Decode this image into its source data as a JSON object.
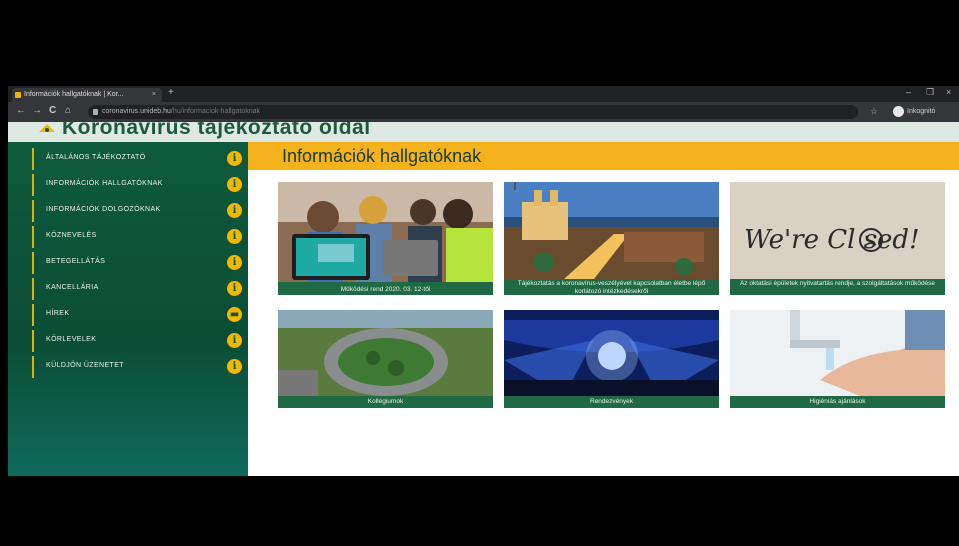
{
  "browser": {
    "tab_title": "Információk hallgatóknak | Kor...",
    "tab_close": "×",
    "new_tab": "+",
    "nav": {
      "back": "←",
      "forward": "→",
      "reload": "C",
      "home": "⌂"
    },
    "url_host": "coronavirus.unideb.hu",
    "url_path": "/hu/informaciok-hallgatoknak",
    "profile_label": "Inkognitó",
    "window_controls": {
      "minimize": "–",
      "restore": "❐",
      "close": "×"
    }
  },
  "site": {
    "title": "Koronavírus tájékoztató oldal",
    "sidebar": [
      {
        "label": "ÁLTALÁNOS TÁJÉKOZTATÓ",
        "icon": "info-icon",
        "glyph": "i"
      },
      {
        "label": "INFORMÁCIÓK HALLGATÓKNAK",
        "icon": "info-icon",
        "glyph": "i"
      },
      {
        "label": "INFORMÁCIÓK DOLGOZÓKNAK",
        "icon": "info-icon",
        "glyph": "i"
      },
      {
        "label": "KÖZNEVELÉS",
        "icon": "info-icon",
        "glyph": "i"
      },
      {
        "label": "BETEGELLÁTÁS",
        "icon": "info-icon",
        "glyph": "i"
      },
      {
        "label": "KANCELLÁRIA",
        "icon": "info-icon",
        "glyph": "i"
      },
      {
        "label": "HÍREK",
        "icon": "chat-icon",
        "glyph": "▬"
      },
      {
        "label": "KÖRLEVELEK",
        "icon": "info-icon",
        "glyph": "i"
      },
      {
        "label": "KÜLDJÖN ÜZENETET",
        "icon": "info-icon",
        "glyph": "i"
      }
    ],
    "heading": "Információk hallgatóknak",
    "cards": [
      {
        "caption": "Működési rend 2020. 03. 12-től",
        "image": "students-laptop-photo"
      },
      {
        "caption": "Tájékoztatás a koronavírus-veszélyével kapcsolatban életbe lépő korlátozó intézkedésekről",
        "image": "city-aerial-photo"
      },
      {
        "caption": "Az oktatási épületek nyitvatartás rendje, a szolgáltatások működése",
        "image": "we-are-closed-sign"
      },
      {
        "caption": "Kollégiumok",
        "image": "dormitory-aerial-photo"
      },
      {
        "caption": "Rendezvények",
        "image": "concert-crowd-photo"
      },
      {
        "caption": "Higiéniás ajánlások",
        "image": "hand-washing-photo"
      }
    ],
    "closed_sign_text": "We're Cl  sed!"
  },
  "colors": {
    "sidebar": "#0e5a3c",
    "accent": "#f4b31d",
    "caption_bg": "#1f6a45"
  }
}
